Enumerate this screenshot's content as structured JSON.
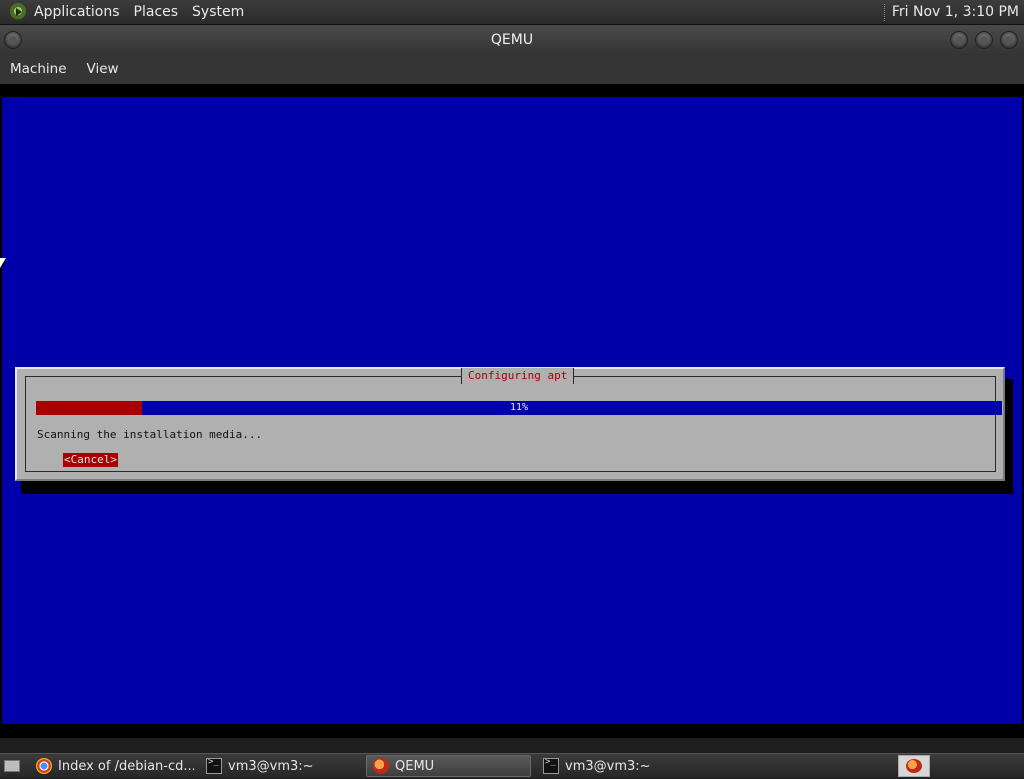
{
  "top_panel": {
    "menu": [
      "Applications",
      "Places",
      "System"
    ],
    "clock": "Fri Nov 1,  3:10 PM"
  },
  "window": {
    "title": "QEMU",
    "menu": [
      "Machine",
      "View"
    ]
  },
  "installer": {
    "dialog_title": "Configuring apt",
    "progress_percent": 11,
    "progress_label": "11%",
    "status": "Scanning the installation media...",
    "cancel_label": "<Cancel>"
  },
  "taskbar": {
    "tasks": [
      {
        "label": "Index of /debian-cd...",
        "icon": "chrome-icon"
      },
      {
        "label": "vm3@vm3:~",
        "icon": "terminal-icon"
      },
      {
        "label": "QEMU",
        "icon": "qemu-icon"
      },
      {
        "label": "vm3@vm3:~",
        "icon": "terminal-icon"
      }
    ]
  },
  "colors": {
    "vm_background": "#0000a8",
    "dialog_bg": "#b0b0b0",
    "accent_red": "#a80000"
  }
}
